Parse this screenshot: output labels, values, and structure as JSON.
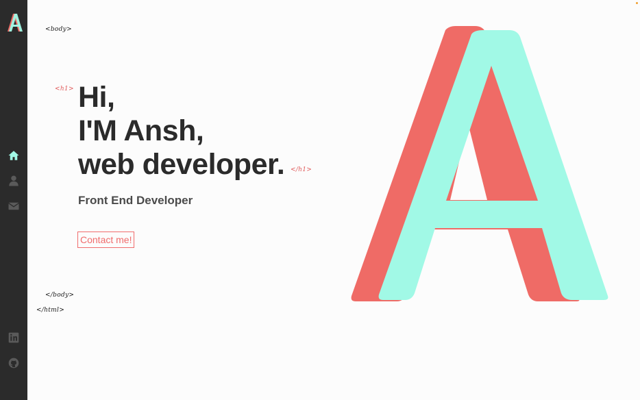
{
  "brand": {
    "logo_letter": "A",
    "colors": {
      "coral": "#ef6b66",
      "mint": "#a1f9e6",
      "sidebar": "#2b2b2b",
      "text": "#2b2b2b"
    }
  },
  "sidebar": {
    "nav": [
      {
        "name": "home",
        "icon": "home-icon",
        "active": true,
        "color": "#a1f9e6"
      },
      {
        "name": "about",
        "icon": "user-icon",
        "active": false,
        "color": "#5a5a5a"
      },
      {
        "name": "contact",
        "icon": "envelope-icon",
        "active": false,
        "color": "#5a5a5a"
      }
    ],
    "social": [
      {
        "name": "linkedin",
        "icon": "linkedin-icon"
      },
      {
        "name": "github",
        "icon": "github-icon"
      }
    ]
  },
  "tags": {
    "body_open": "<body>",
    "h1_open": "<h1>",
    "h1_close": "</h1>",
    "body_close": "</body>",
    "html_close": "</html>"
  },
  "hero": {
    "line1": "Hi,",
    "line2": "I'M Ansh,",
    "line3": "web developer.",
    "subtitle": "Front End Developer",
    "cta": "Contact me!",
    "big_letter": "A"
  }
}
